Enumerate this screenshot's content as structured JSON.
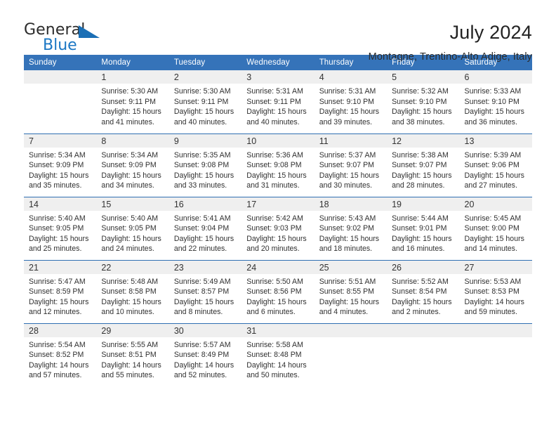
{
  "brand": {
    "name_top": "General",
    "name_bottom": "Blue",
    "triangle_color": "#1b6fb5",
    "blue_text_color": "#1b77c4"
  },
  "header": {
    "title": "July 2024",
    "subtitle": "Montagne, Trentino-Alto Adige, Italy"
  },
  "theme": {
    "header_bg": "#3573b9",
    "header_text": "#ffffff",
    "row_divider": "#2f6fb2",
    "daynum_bg": "#efefef"
  },
  "calendar": {
    "weekday_headers": [
      "Sunday",
      "Monday",
      "Tuesday",
      "Wednesday",
      "Thursday",
      "Friday",
      "Saturday"
    ],
    "weeks": [
      [
        {
          "day": "",
          "sunrise": "",
          "sunset": "",
          "daylight_1": "",
          "daylight_2": ""
        },
        {
          "day": "1",
          "sunrise": "Sunrise: 5:30 AM",
          "sunset": "Sunset: 9:11 PM",
          "daylight_1": "Daylight: 15 hours",
          "daylight_2": "and 41 minutes."
        },
        {
          "day": "2",
          "sunrise": "Sunrise: 5:30 AM",
          "sunset": "Sunset: 9:11 PM",
          "daylight_1": "Daylight: 15 hours",
          "daylight_2": "and 40 minutes."
        },
        {
          "day": "3",
          "sunrise": "Sunrise: 5:31 AM",
          "sunset": "Sunset: 9:11 PM",
          "daylight_1": "Daylight: 15 hours",
          "daylight_2": "and 40 minutes."
        },
        {
          "day": "4",
          "sunrise": "Sunrise: 5:31 AM",
          "sunset": "Sunset: 9:10 PM",
          "daylight_1": "Daylight: 15 hours",
          "daylight_2": "and 39 minutes."
        },
        {
          "day": "5",
          "sunrise": "Sunrise: 5:32 AM",
          "sunset": "Sunset: 9:10 PM",
          "daylight_1": "Daylight: 15 hours",
          "daylight_2": "and 38 minutes."
        },
        {
          "day": "6",
          "sunrise": "Sunrise: 5:33 AM",
          "sunset": "Sunset: 9:10 PM",
          "daylight_1": "Daylight: 15 hours",
          "daylight_2": "and 36 minutes."
        }
      ],
      [
        {
          "day": "7",
          "sunrise": "Sunrise: 5:34 AM",
          "sunset": "Sunset: 9:09 PM",
          "daylight_1": "Daylight: 15 hours",
          "daylight_2": "and 35 minutes."
        },
        {
          "day": "8",
          "sunrise": "Sunrise: 5:34 AM",
          "sunset": "Sunset: 9:09 PM",
          "daylight_1": "Daylight: 15 hours",
          "daylight_2": "and 34 minutes."
        },
        {
          "day": "9",
          "sunrise": "Sunrise: 5:35 AM",
          "sunset": "Sunset: 9:08 PM",
          "daylight_1": "Daylight: 15 hours",
          "daylight_2": "and 33 minutes."
        },
        {
          "day": "10",
          "sunrise": "Sunrise: 5:36 AM",
          "sunset": "Sunset: 9:08 PM",
          "daylight_1": "Daylight: 15 hours",
          "daylight_2": "and 31 minutes."
        },
        {
          "day": "11",
          "sunrise": "Sunrise: 5:37 AM",
          "sunset": "Sunset: 9:07 PM",
          "daylight_1": "Daylight: 15 hours",
          "daylight_2": "and 30 minutes."
        },
        {
          "day": "12",
          "sunrise": "Sunrise: 5:38 AM",
          "sunset": "Sunset: 9:07 PM",
          "daylight_1": "Daylight: 15 hours",
          "daylight_2": "and 28 minutes."
        },
        {
          "day": "13",
          "sunrise": "Sunrise: 5:39 AM",
          "sunset": "Sunset: 9:06 PM",
          "daylight_1": "Daylight: 15 hours",
          "daylight_2": "and 27 minutes."
        }
      ],
      [
        {
          "day": "14",
          "sunrise": "Sunrise: 5:40 AM",
          "sunset": "Sunset: 9:05 PM",
          "daylight_1": "Daylight: 15 hours",
          "daylight_2": "and 25 minutes."
        },
        {
          "day": "15",
          "sunrise": "Sunrise: 5:40 AM",
          "sunset": "Sunset: 9:05 PM",
          "daylight_1": "Daylight: 15 hours",
          "daylight_2": "and 24 minutes."
        },
        {
          "day": "16",
          "sunrise": "Sunrise: 5:41 AM",
          "sunset": "Sunset: 9:04 PM",
          "daylight_1": "Daylight: 15 hours",
          "daylight_2": "and 22 minutes."
        },
        {
          "day": "17",
          "sunrise": "Sunrise: 5:42 AM",
          "sunset": "Sunset: 9:03 PM",
          "daylight_1": "Daylight: 15 hours",
          "daylight_2": "and 20 minutes."
        },
        {
          "day": "18",
          "sunrise": "Sunrise: 5:43 AM",
          "sunset": "Sunset: 9:02 PM",
          "daylight_1": "Daylight: 15 hours",
          "daylight_2": "and 18 minutes."
        },
        {
          "day": "19",
          "sunrise": "Sunrise: 5:44 AM",
          "sunset": "Sunset: 9:01 PM",
          "daylight_1": "Daylight: 15 hours",
          "daylight_2": "and 16 minutes."
        },
        {
          "day": "20",
          "sunrise": "Sunrise: 5:45 AM",
          "sunset": "Sunset: 9:00 PM",
          "daylight_1": "Daylight: 15 hours",
          "daylight_2": "and 14 minutes."
        }
      ],
      [
        {
          "day": "21",
          "sunrise": "Sunrise: 5:47 AM",
          "sunset": "Sunset: 8:59 PM",
          "daylight_1": "Daylight: 15 hours",
          "daylight_2": "and 12 minutes."
        },
        {
          "day": "22",
          "sunrise": "Sunrise: 5:48 AM",
          "sunset": "Sunset: 8:58 PM",
          "daylight_1": "Daylight: 15 hours",
          "daylight_2": "and 10 minutes."
        },
        {
          "day": "23",
          "sunrise": "Sunrise: 5:49 AM",
          "sunset": "Sunset: 8:57 PM",
          "daylight_1": "Daylight: 15 hours",
          "daylight_2": "and 8 minutes."
        },
        {
          "day": "24",
          "sunrise": "Sunrise: 5:50 AM",
          "sunset": "Sunset: 8:56 PM",
          "daylight_1": "Daylight: 15 hours",
          "daylight_2": "and 6 minutes."
        },
        {
          "day": "25",
          "sunrise": "Sunrise: 5:51 AM",
          "sunset": "Sunset: 8:55 PM",
          "daylight_1": "Daylight: 15 hours",
          "daylight_2": "and 4 minutes."
        },
        {
          "day": "26",
          "sunrise": "Sunrise: 5:52 AM",
          "sunset": "Sunset: 8:54 PM",
          "daylight_1": "Daylight: 15 hours",
          "daylight_2": "and 2 minutes."
        },
        {
          "day": "27",
          "sunrise": "Sunrise: 5:53 AM",
          "sunset": "Sunset: 8:53 PM",
          "daylight_1": "Daylight: 14 hours",
          "daylight_2": "and 59 minutes."
        }
      ],
      [
        {
          "day": "28",
          "sunrise": "Sunrise: 5:54 AM",
          "sunset": "Sunset: 8:52 PM",
          "daylight_1": "Daylight: 14 hours",
          "daylight_2": "and 57 minutes."
        },
        {
          "day": "29",
          "sunrise": "Sunrise: 5:55 AM",
          "sunset": "Sunset: 8:51 PM",
          "daylight_1": "Daylight: 14 hours",
          "daylight_2": "and 55 minutes."
        },
        {
          "day": "30",
          "sunrise": "Sunrise: 5:57 AM",
          "sunset": "Sunset: 8:49 PM",
          "daylight_1": "Daylight: 14 hours",
          "daylight_2": "and 52 minutes."
        },
        {
          "day": "31",
          "sunrise": "Sunrise: 5:58 AM",
          "sunset": "Sunset: 8:48 PM",
          "daylight_1": "Daylight: 14 hours",
          "daylight_2": "and 50 minutes."
        },
        {
          "day": "",
          "sunrise": "",
          "sunset": "",
          "daylight_1": "",
          "daylight_2": ""
        },
        {
          "day": "",
          "sunrise": "",
          "sunset": "",
          "daylight_1": "",
          "daylight_2": ""
        },
        {
          "day": "",
          "sunrise": "",
          "sunset": "",
          "daylight_1": "",
          "daylight_2": ""
        }
      ]
    ]
  }
}
